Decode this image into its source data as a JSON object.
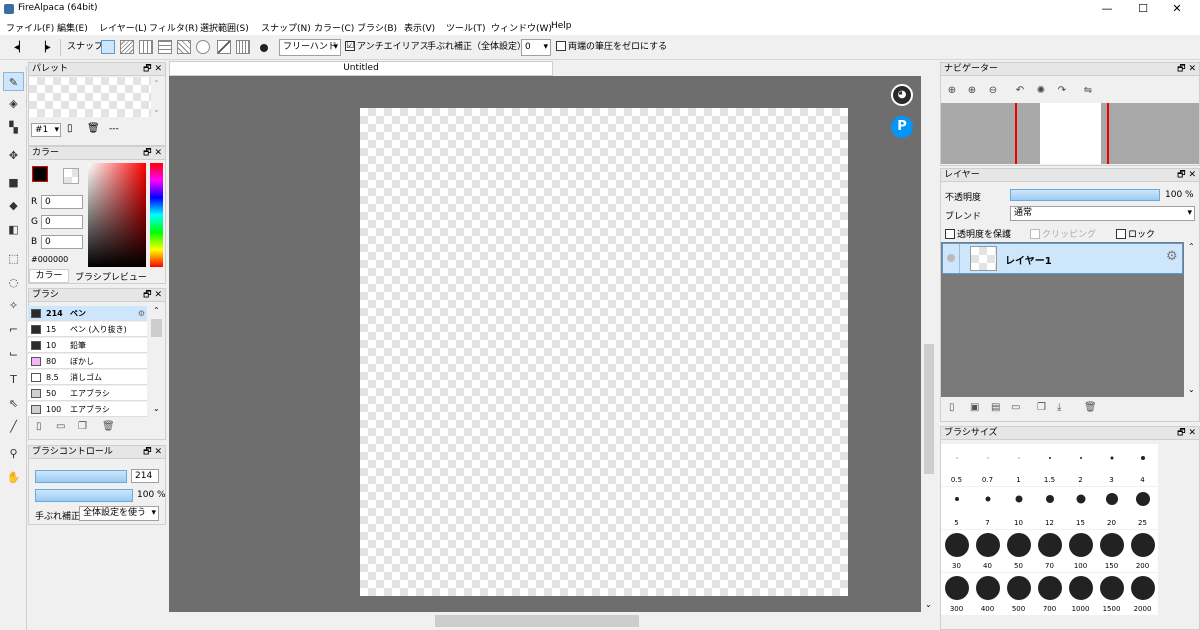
{
  "window": {
    "title": "FireAlpaca (64bit)",
    "minimize": "—",
    "maximize": "☐",
    "close": "✕"
  },
  "menu": [
    "ファイル(F)",
    "編集(E)",
    "レイヤー(L)",
    "フィルタ(R)",
    "選択範囲(S)",
    "スナップ(N)",
    "カラー(C)",
    "ブラシ(B)",
    "表示(V)",
    "ツール(T)",
    "ウィンドウ(W)",
    "Help"
  ],
  "toolbar": {
    "snap_label": "スナップ",
    "draw_mode": "フリーハンド",
    "antialias_label": "アンチエイリアス",
    "antialias_checked": "☑",
    "stabilizer_label": "手ぶれ補正（全体設定）",
    "stabilizer_value": "0",
    "pressure_label": "両端の筆圧をゼロにする"
  },
  "tools": [
    "pen-tool",
    "eraser-tool",
    "dot-tool",
    "move-tool",
    "fill-rect-tool",
    "bucket-tool",
    "gradient-tool",
    "select-tool",
    "lasso-tool",
    "magic-wand-tool",
    "select-pen-tool",
    "select-eraser-tool",
    "text-tool",
    "operation-tool",
    "blur-tool",
    "eyedropper-tool",
    "hand-tool"
  ],
  "palette": {
    "title": "パレット",
    "selector": "#1",
    "name": "---"
  },
  "color": {
    "title": "カラー",
    "r_label": "R",
    "g_label": "G",
    "b_label": "B",
    "r": "0",
    "g": "0",
    "b": "0",
    "hex": "#000000",
    "tab_color": "カラー",
    "tab_preview": "ブラシプレビュー",
    "primary": "#000000"
  },
  "brush": {
    "title": "ブラシ",
    "items": [
      {
        "size": "214",
        "name": "ペン",
        "color": "#2b2b2b"
      },
      {
        "size": "15",
        "name": "ペン (入り抜き)",
        "color": "#2b2b2b"
      },
      {
        "size": "10",
        "name": "鉛筆",
        "color": "#2b2b2b"
      },
      {
        "size": "80",
        "name": "ぼかし",
        "color": "#f7b5f7"
      },
      {
        "size": "8.5",
        "name": "消しゴム",
        "color": "#ffffff"
      },
      {
        "size": "50",
        "name": "エアブラシ",
        "color": "#d0d0d0"
      },
      {
        "size": "100",
        "name": "エアブラシ",
        "color": "#d0d0d0"
      }
    ]
  },
  "brush_control": {
    "title": "ブラシコントロール",
    "size": "214",
    "opacity": "100 %",
    "stabilizer_label": "手ぶれ補正",
    "stabilizer_value": "全体設定を使う"
  },
  "canvas": {
    "tab": "Untitled"
  },
  "navigator": {
    "title": "ナビゲーター"
  },
  "layer": {
    "title": "レイヤー",
    "opacity_label": "不透明度",
    "opacity_value": "100 %",
    "blend_label": "ブレンド",
    "blend_value": "通常",
    "protect_label": "透明度を保護",
    "clipping_label": "クリッピング",
    "lock_label": "ロック",
    "layer_name": "レイヤー1"
  },
  "brush_size": {
    "title": "ブラシサイズ",
    "sizes": [
      "0.5",
      "0.7",
      "1",
      "1.5",
      "2",
      "3",
      "4",
      "5",
      "7",
      "10",
      "12",
      "15",
      "20",
      "25",
      "30",
      "40",
      "50",
      "70",
      "100",
      "150",
      "200",
      "300",
      "400",
      "500",
      "700",
      "1000",
      "1500",
      "2000"
    ]
  }
}
